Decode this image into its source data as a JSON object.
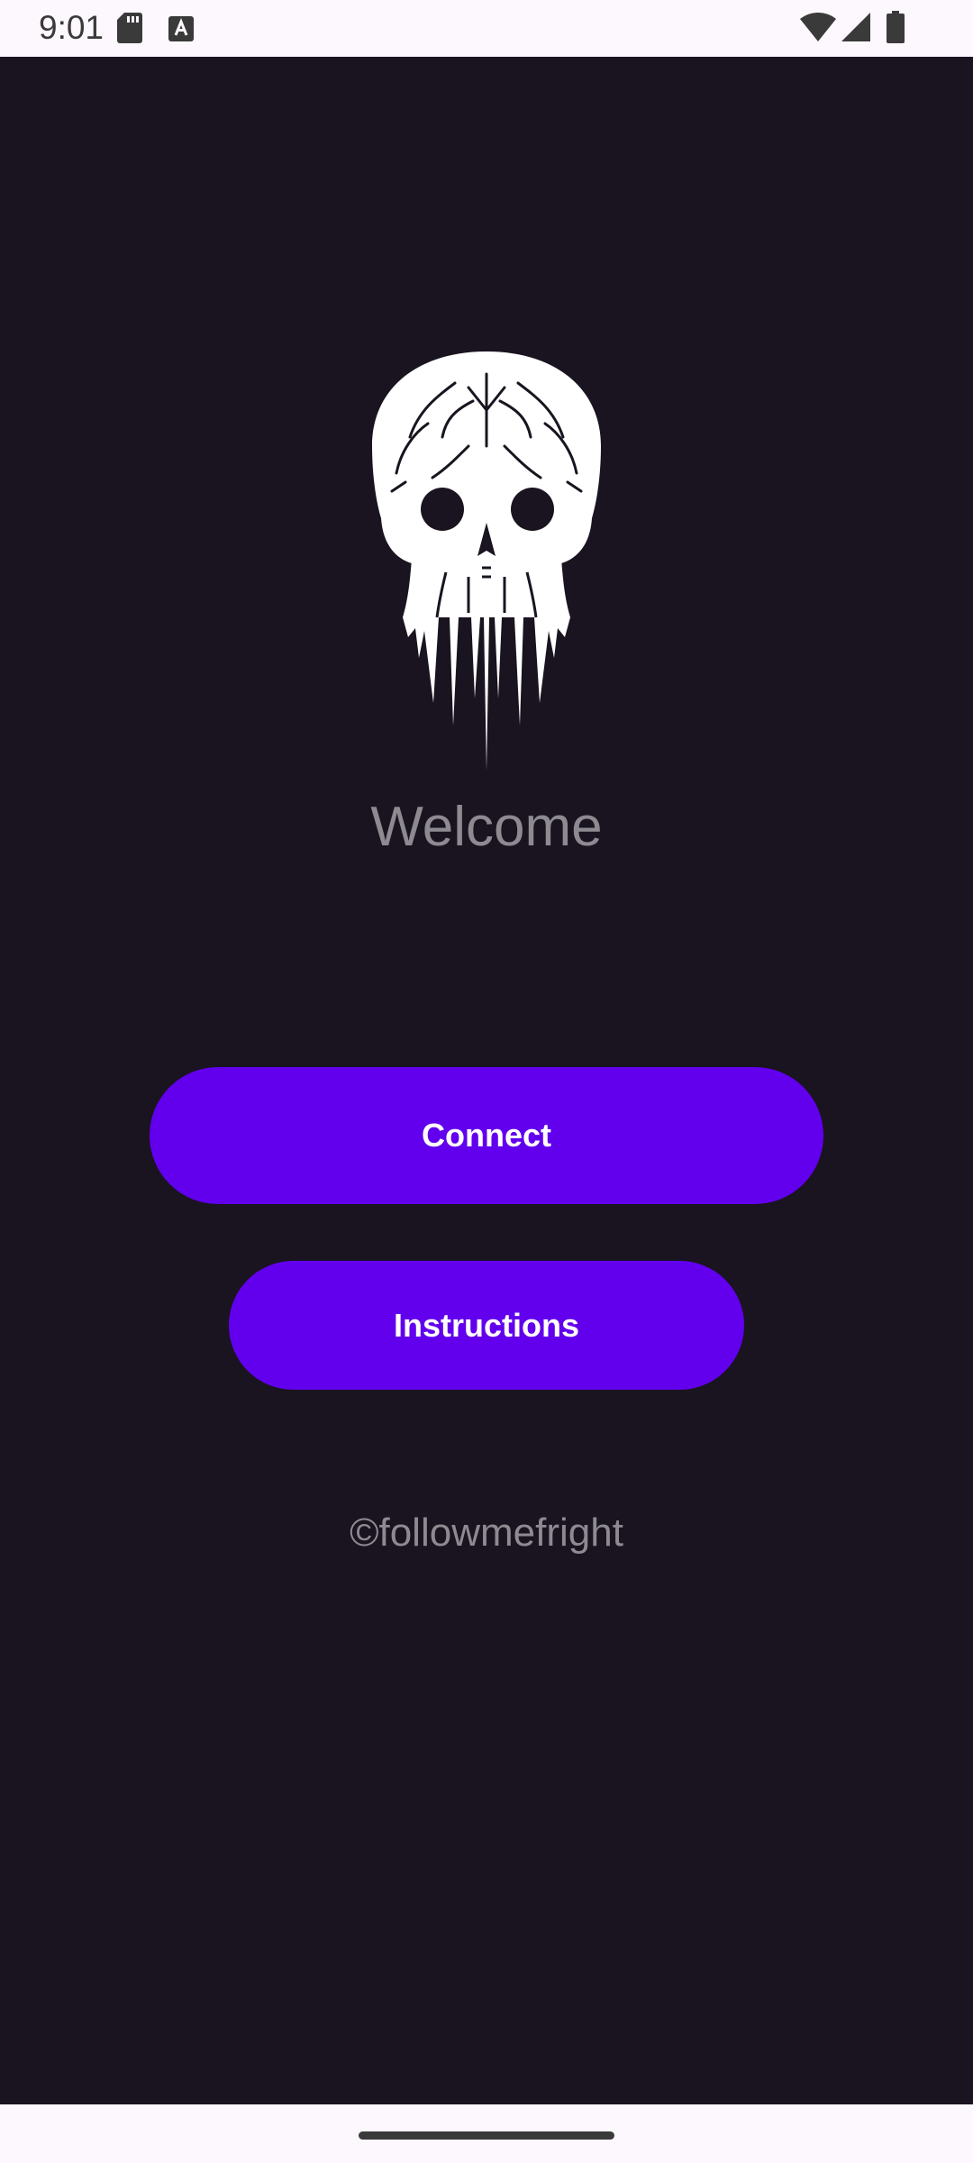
{
  "status_bar": {
    "time": "9:01",
    "icons": [
      "sd-card-icon",
      "keyboard-a-icon",
      "wifi-icon",
      "cellular-signal-icon",
      "battery-icon"
    ]
  },
  "main": {
    "logo": "skull-logo",
    "welcome_text": "Welcome",
    "connect_label": "Connect",
    "instructions_label": "Instructions",
    "copyright": "©followmefright"
  },
  "colors": {
    "background": "#19141f",
    "accent": "#6200ee",
    "muted_text": "#8e8a92",
    "system_bars": "#fdf8fd"
  }
}
